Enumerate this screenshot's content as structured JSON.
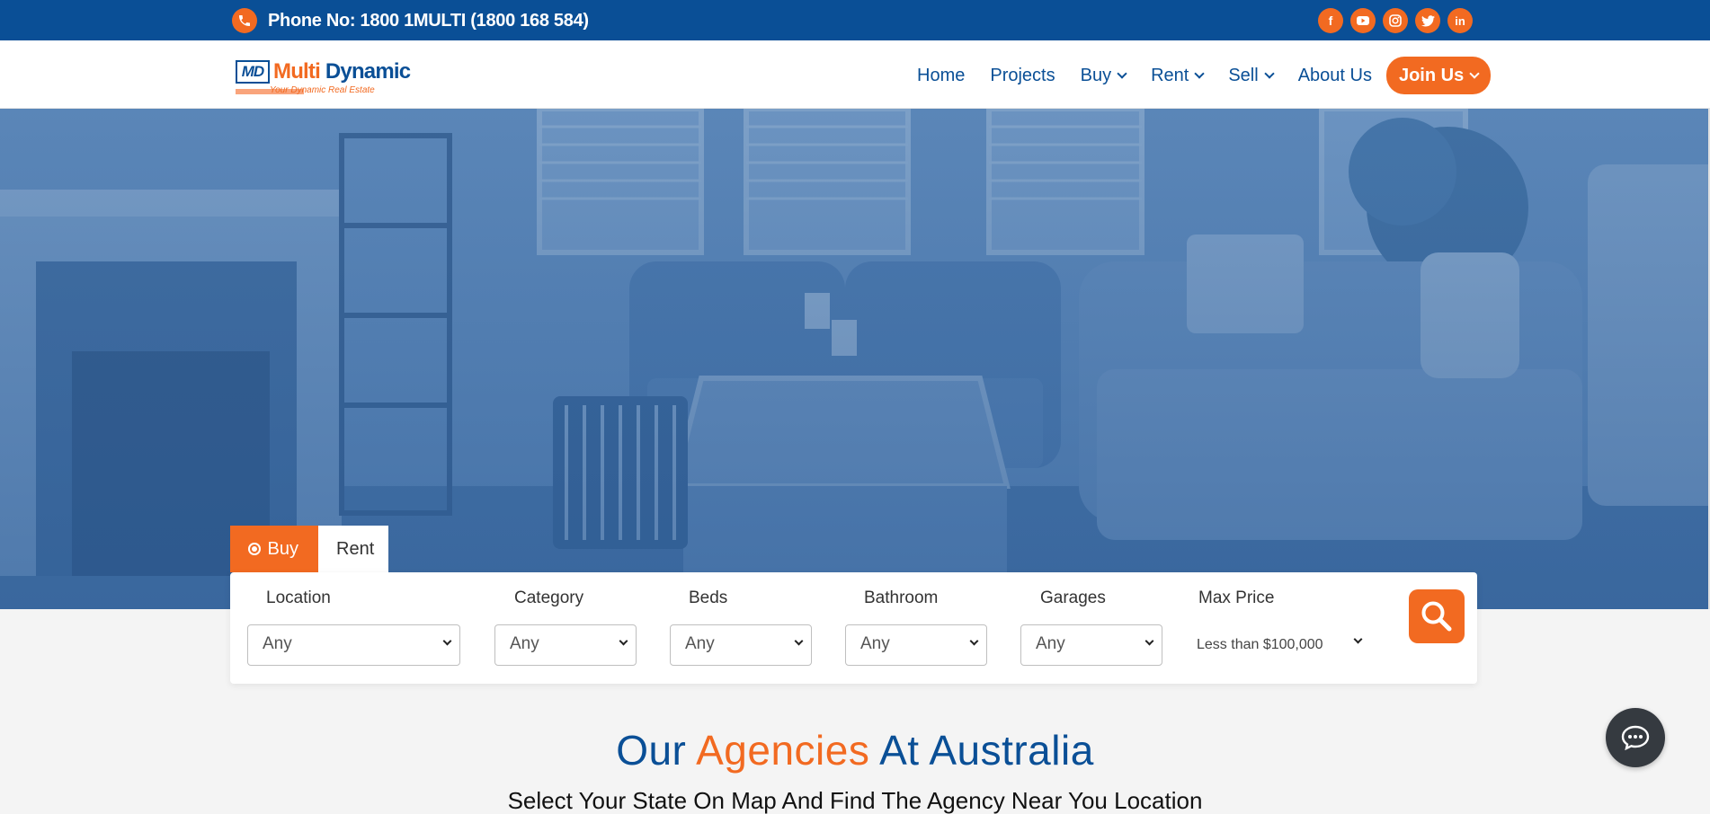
{
  "topbar": {
    "phone_text": "Phone No: 1800 1MULTI (1800 168 584)",
    "phone_icon": "phone-icon",
    "socials": [
      {
        "name": "facebook-icon",
        "glyph": "f"
      },
      {
        "name": "youtube-icon",
        "glyph": "▶"
      },
      {
        "name": "instagram-icon",
        "glyph": "◎"
      },
      {
        "name": "twitter-icon",
        "glyph": "t"
      },
      {
        "name": "linkedin-icon",
        "glyph": "in"
      }
    ]
  },
  "logo": {
    "mark": "MD",
    "name_part1": "Multi",
    "name_part2": "Dynamic",
    "tagline": "Your Dynamic Real Estate"
  },
  "nav": {
    "home": "Home",
    "projects": "Projects",
    "buy": "Buy",
    "rent": "Rent",
    "sell": "Sell",
    "about": "About Us",
    "join": "Join Us"
  },
  "search": {
    "tab_buy": "Buy",
    "tab_rent": "Rent",
    "location_label": "Location",
    "location_value": "Any",
    "category_label": "Category",
    "category_value": "Any",
    "beds_label": "Beds",
    "beds_value": "Any",
    "bathroom_label": "Bathroom",
    "bathroom_value": "Any",
    "garages_label": "Garages",
    "garages_value": "Any",
    "maxprice_label": "Max Price",
    "maxprice_value": "Less than $100,000"
  },
  "section": {
    "title_part1": "Our",
    "title_part2": "Agencies",
    "title_part3": "At Australia",
    "subtitle": "Select Your State On Map And Find The Agency Near You Location"
  },
  "colors": {
    "brand_blue": "#0a4f96",
    "accent_orange": "#f26a21"
  }
}
